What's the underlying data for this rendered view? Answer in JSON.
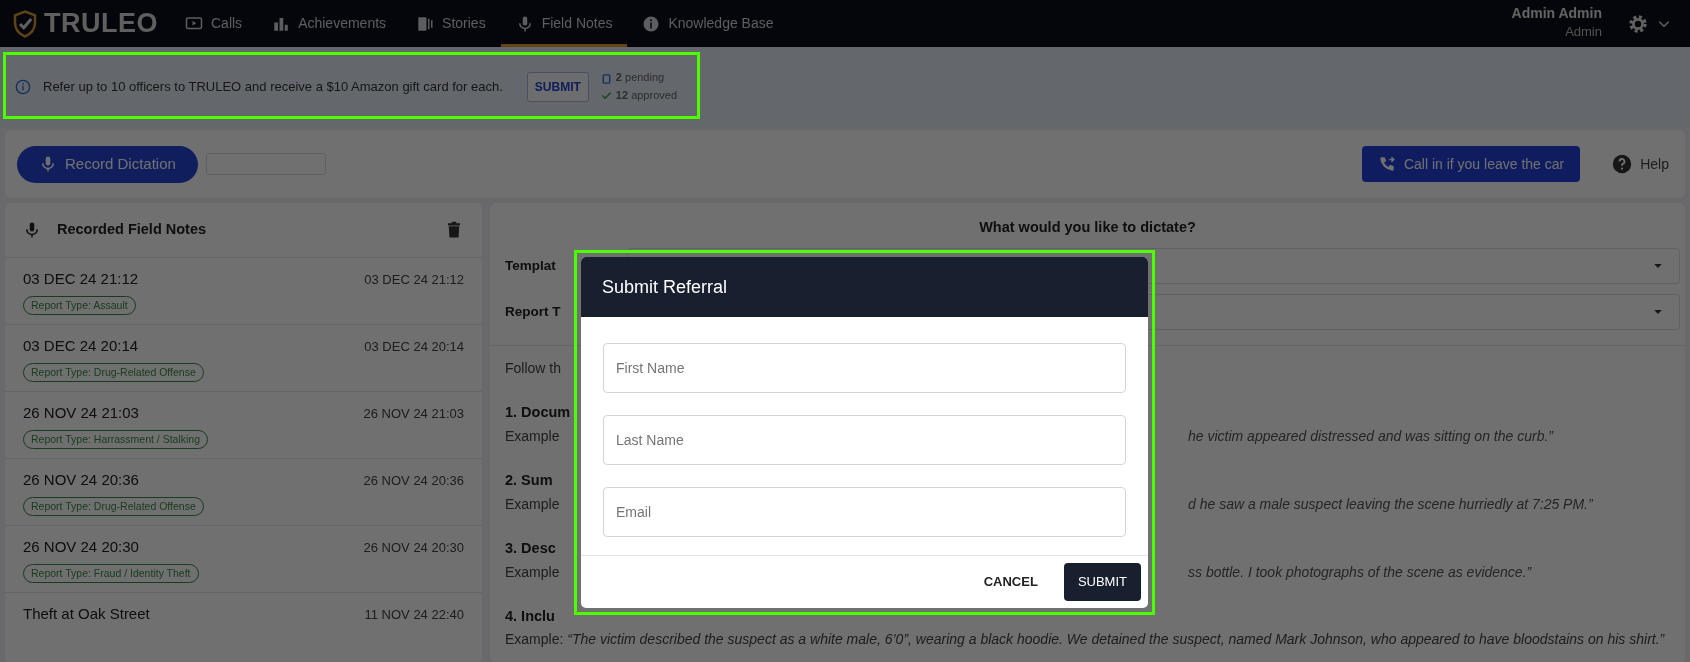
{
  "nav": {
    "logo": "TRULEO",
    "items": [
      {
        "label": "Calls",
        "selected": false
      },
      {
        "label": "Achievements",
        "selected": false
      },
      {
        "label": "Stories",
        "selected": false
      },
      {
        "label": "Field Notes",
        "selected": true
      },
      {
        "label": "Knowledge Base",
        "selected": false
      }
    ],
    "user": {
      "name": "Admin Admin",
      "role": "Admin"
    }
  },
  "banner": {
    "text": "Refer up to 10 officers to TRULEO and receive a $10 Amazon gift card for each.",
    "button": "SUBMIT",
    "pending": "**2** pending",
    "approved": "**12** approved"
  },
  "toolbar": {
    "record_button": "Record Dictation",
    "call_button": "Call in if you leave the car",
    "help": "Help"
  },
  "field_notes": {
    "title": "Recorded Field Notes",
    "items": [
      {
        "title": "03 DEC 24 21:12",
        "time": "03 DEC 24 21:12",
        "report_type": "Report Type: Assault"
      },
      {
        "title": "03 DEC 24 20:14",
        "time": "03 DEC 24 20:14",
        "report_type": "Report Type: Drug-Related Offense"
      },
      {
        "title": "26 NOV 24 21:03",
        "time": "26 NOV 24 21:03",
        "report_type": "Report Type: Harrassment / Stalking"
      },
      {
        "title": "26 NOV 24 20:36",
        "time": "26 NOV 24 20:36",
        "report_type": "Report Type: Drug-Related Offense"
      },
      {
        "title": "26 NOV 24 20:30",
        "time": "26 NOV 24 20:30",
        "report_type": "Report Type: Fraud / Identity Theft"
      },
      {
        "title": "Theft at Oak Street",
        "time": "11 NOV 24 22:40"
      }
    ]
  },
  "dictation": {
    "title": "What would you like to dictate?",
    "fields": [
      {
        "label": "Templat"
      },
      {
        "label": "Report T"
      }
    ],
    "intro": "Follow th",
    "steps": [
      {
        "heading": "1. Docum",
        "example": "Example",
        "example_tail": "he victim appeared distressed and was sitting on the curb.”"
      },
      {
        "heading": "2. Sum",
        "example": "Example",
        "example_tail": "d he saw a male suspect leaving the scene hurriedly at 7:25 PM.”"
      },
      {
        "heading": "3. Desc",
        "example": "Example",
        "example_tail": "ss bottle. I took photographs of the scene as evidence.”"
      },
      {
        "heading": "4. Inclu",
        "example": "Example: *“The victim described the suspect as a white male, 6’0”, wearing a black hoodie. We detained the suspect, named Mark Johnson, who appeared to have bloodstains on his shirt.”*"
      }
    ]
  },
  "modal": {
    "title": "Submit Referral",
    "fields": [
      {
        "placeholder": "First Name"
      },
      {
        "placeholder": "Last Name"
      },
      {
        "placeholder": "Email"
      }
    ],
    "cancel": "CANCEL",
    "submit": "SUBMIT"
  }
}
